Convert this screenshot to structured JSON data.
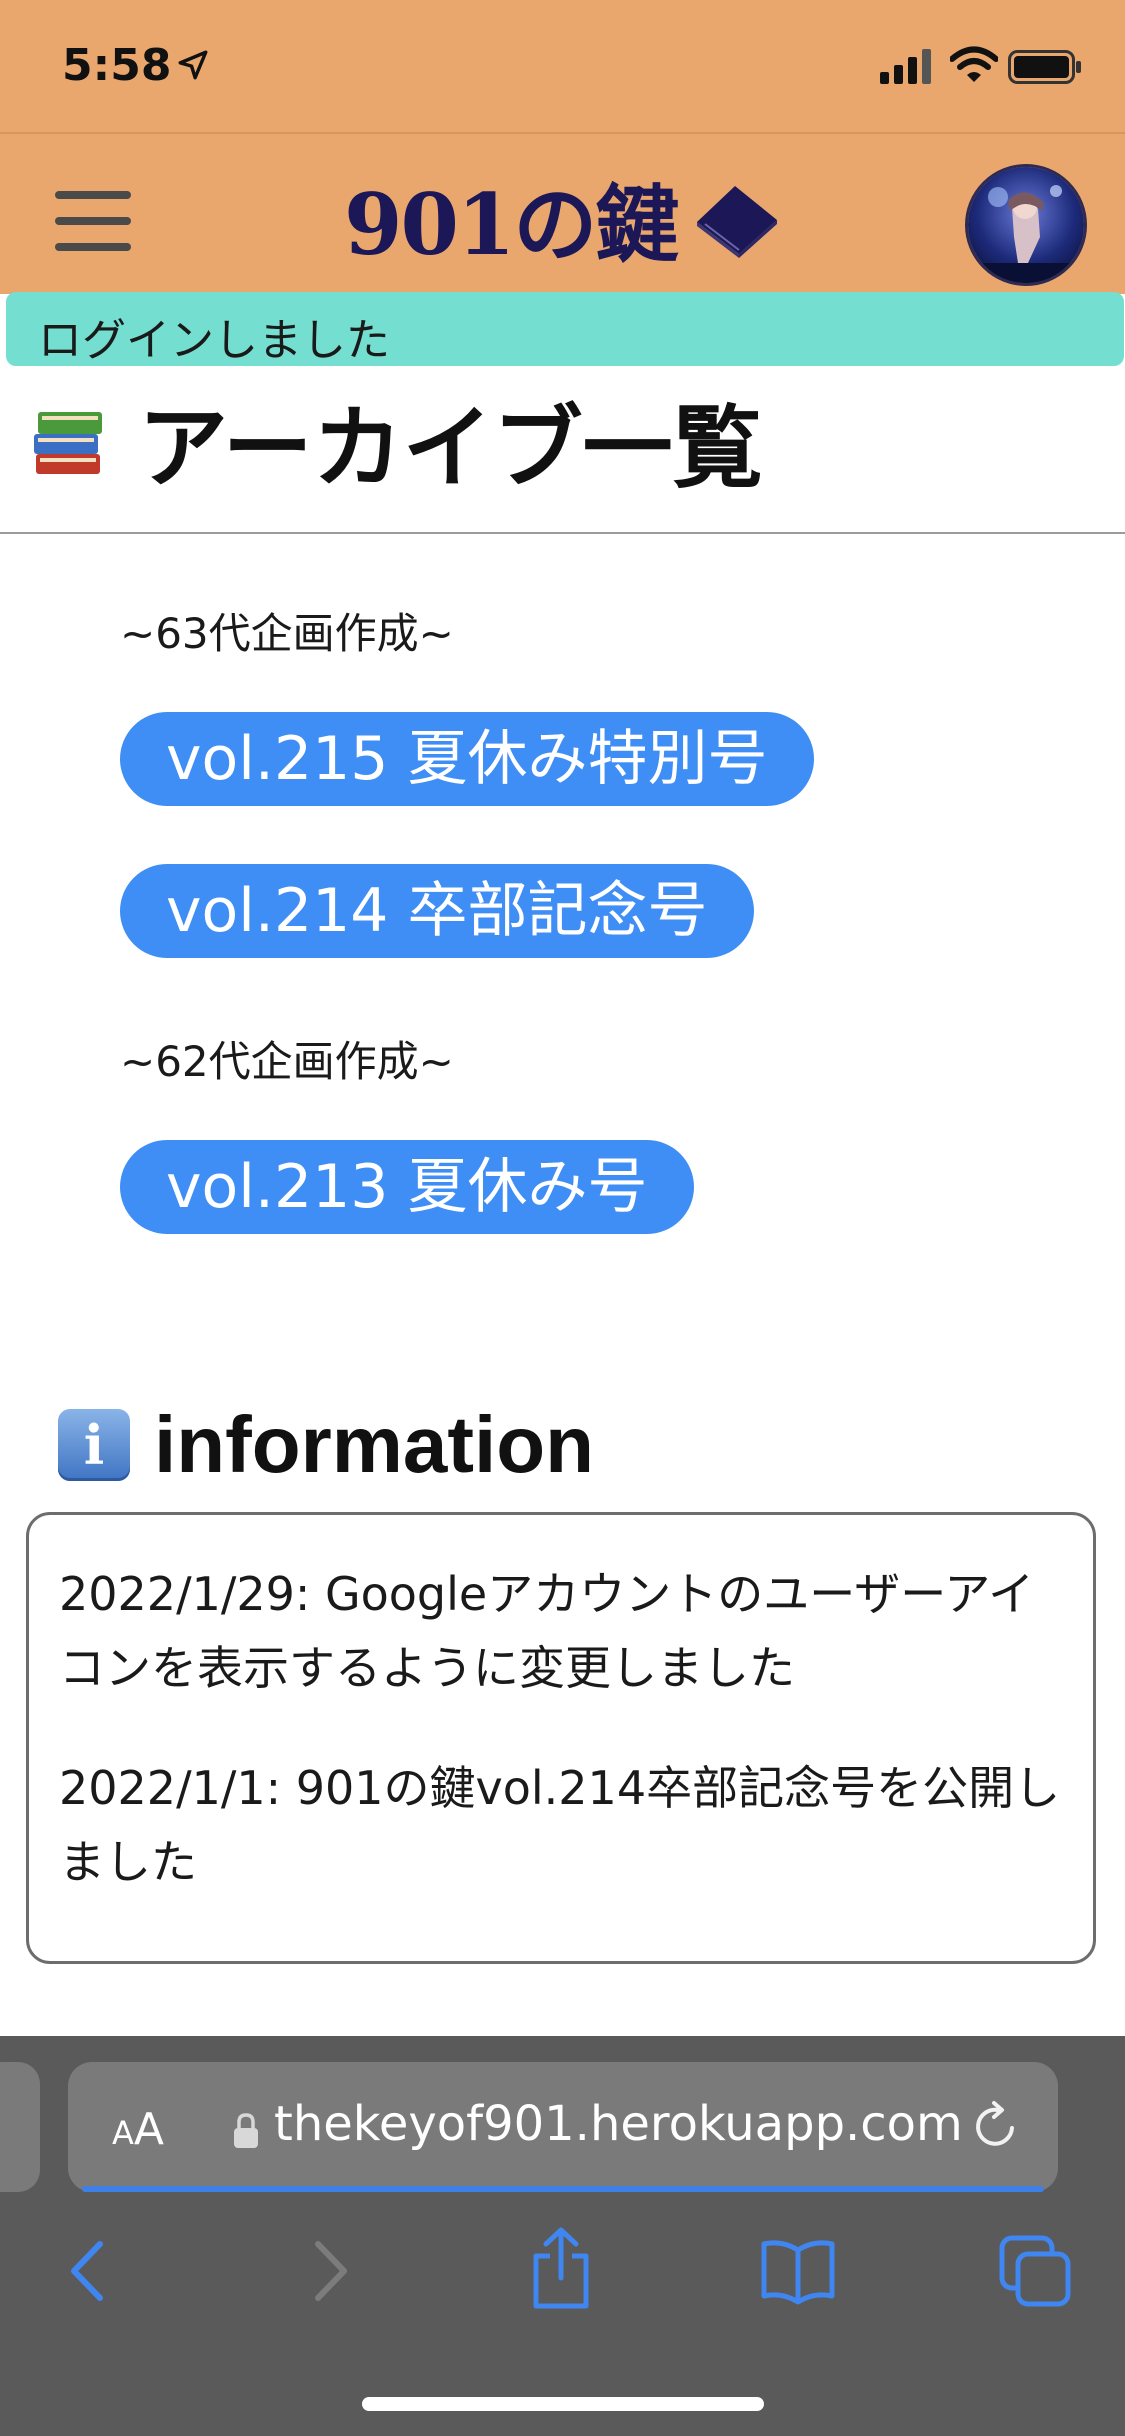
{
  "status_bar": {
    "time": "5:58"
  },
  "header": {
    "logo_text": "901の鍵"
  },
  "flash": {
    "message": "ログインしました"
  },
  "archive": {
    "title": "アーカイブ一覧",
    "groups": [
      {
        "label": "~63代企画作成~",
        "items": [
          "vol.215 夏休み特別号",
          "vol.214 卒部記念号"
        ]
      },
      {
        "label": "~62代企画作成~",
        "items": [
          "vol.213 夏休み号"
        ]
      }
    ]
  },
  "information": {
    "title": "information",
    "entries": [
      "2022/1/29: Googleアカウントのユーザーアイコンを表示するように変更しました",
      "2022/1/1: 901の鍵vol.214卒部記念号を公開しました"
    ]
  },
  "browser": {
    "aa_small": "A",
    "aa_big": "A",
    "url": "thekeyof901.herokuapp.com"
  },
  "colors": {
    "header_bg": "#e9a66d",
    "flash_bg": "#74ded0",
    "button_bg": "#3f8ef5",
    "logo_text": "#1c1756",
    "browser_bg": "#5a5a5a",
    "browser_accent": "#3f7fe8"
  },
  "icons": {
    "location": "location-arrow-icon",
    "signal": "cellular-signal-icon",
    "wifi": "wifi-icon",
    "battery": "battery-icon",
    "menu": "hamburger-menu-icon",
    "logo_book": "book-icon",
    "title_icon": "books-icon",
    "info_icon": "information-icon",
    "lock": "lock-icon",
    "reload": "reload-icon",
    "back": "back-chevron-icon",
    "forward": "forward-chevron-icon",
    "share": "share-icon",
    "bookmarks": "bookmarks-icon",
    "tabs": "tabs-icon"
  }
}
